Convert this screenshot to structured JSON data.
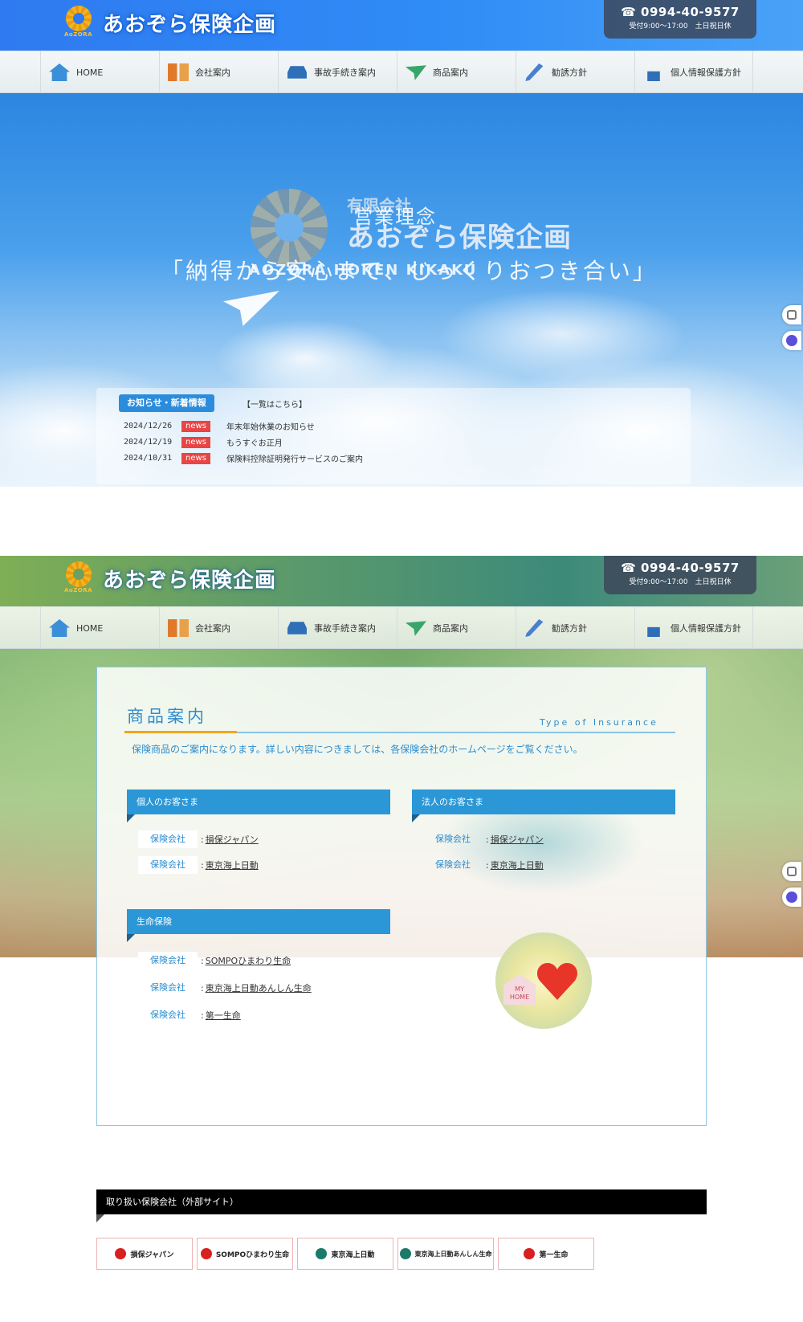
{
  "header": {
    "logo_wordmark": "AoZORA",
    "site_title": "あおぞら保険企画",
    "phone": "☎ 0994-40-9577",
    "hours": "受付9:00～17:00　土日祝日休"
  },
  "nav": {
    "items": [
      {
        "label": "HOME",
        "icon": "home-icon"
      },
      {
        "label": "会社案内",
        "icon": "building-icon"
      },
      {
        "label": "事故手続き案内",
        "icon": "car-icon"
      },
      {
        "label": "商品案内",
        "icon": "paper-plane-icon"
      },
      {
        "label": "勧誘方針",
        "icon": "pen-icon"
      },
      {
        "label": "個人情報保護方針",
        "icon": "lock-icon"
      }
    ]
  },
  "hero": {
    "company_type": "有限会社",
    "company_name": "あおぞら保険企画",
    "romaji": "AOZORA HOKEN KIKAKU",
    "concept_label": "営業理念",
    "motto": "「納得から安心まで、じっくりおつき合い」"
  },
  "news": {
    "heading": "お知らせ・新着情報",
    "more_link": "【一覧はこちら】",
    "items": [
      {
        "date": "2024/12/26",
        "tag": "news",
        "title": "年末年始休業のお知らせ"
      },
      {
        "date": "2024/12/19",
        "tag": "news",
        "title": "もうすぐお正月"
      },
      {
        "date": "2024/10/31",
        "tag": "news",
        "title": "保険料控除証明発行サービスのご案内"
      }
    ]
  },
  "products": {
    "title": "商品案内",
    "subtitle": "Type of Insurance",
    "intro": "保険商品のご案内になります。詳しい内容につきましては、各保険会社のホームページをご覧ください。",
    "company_label": "保険会社",
    "personal": {
      "heading": "個人のお客さま",
      "companies": [
        "損保ジャパン",
        "東京海上日動"
      ]
    },
    "corporate": {
      "heading": "法人のお客さま",
      "companies": [
        "損保ジャパン",
        "東京海上日動"
      ]
    },
    "life": {
      "heading": "生命保険",
      "companies": [
        "SOMPOひまわり生命",
        "東京海上日動あんしん生命",
        "第一生命"
      ]
    },
    "badge_text": "MY HOME"
  },
  "partners": {
    "heading": "取り扱い保険会社（外部サイト）",
    "items": [
      {
        "name": "損保ジャパン",
        "color": "#d8201f"
      },
      {
        "name": "SOMPOひまわり生命",
        "color": "#d8201f"
      },
      {
        "name": "東京海上日動",
        "color": "#1b7a6a"
      },
      {
        "name": "東京海上日動あんしん生命",
        "color": "#1b7a6a"
      },
      {
        "name": "第一生命",
        "color": "#d8201f"
      }
    ]
  },
  "colors": {
    "accent_blue": "#2b8cd0",
    "news_tag": "#e84545",
    "underline_orange": "#f2a51e"
  }
}
